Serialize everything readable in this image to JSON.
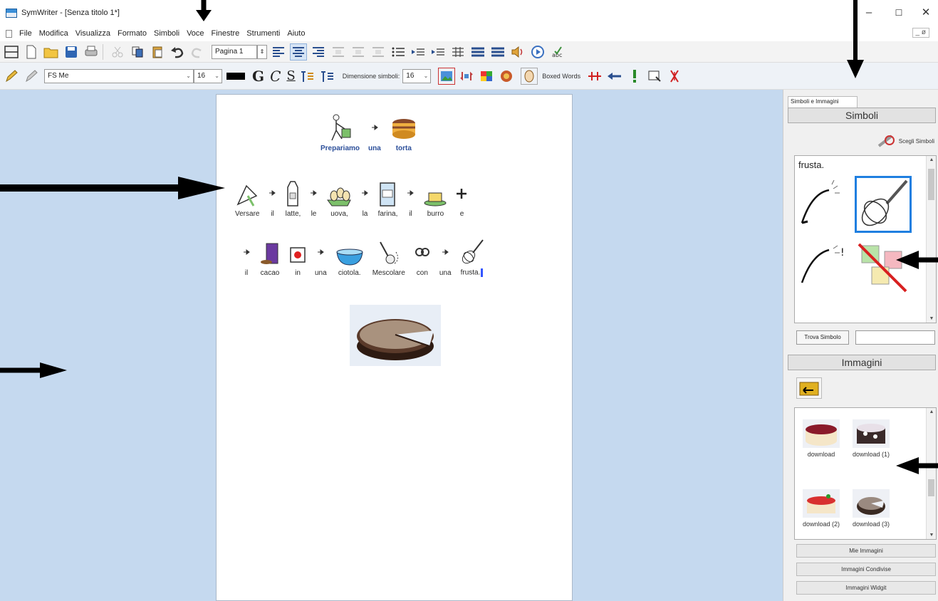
{
  "window": {
    "title": "SymWriter - [Senza titolo 1*]",
    "controls": {
      "minimize": "–",
      "maximize": "☐",
      "close": "✕"
    }
  },
  "menu": {
    "items": [
      "File",
      "Modifica",
      "Visualizza",
      "Formato",
      "Simboli",
      "Voce",
      "Finestre",
      "Strumenti",
      "Aiuto"
    ],
    "mdi_controls": "_ ø"
  },
  "toolbar1": {
    "page_selector": "Pagina 1"
  },
  "toolbar2": {
    "font_name": "FS Me",
    "font_size": "16",
    "bold_label": "G",
    "italic_label": "C",
    "underline_label": "S",
    "symbol_size_label": "Dimensione simboli:",
    "symbol_size_value": "16",
    "boxed_words_label": "Boxed Words"
  },
  "document": {
    "title_row": [
      "Prepariamo",
      "una",
      "torta"
    ],
    "row1": [
      "Versare",
      "il",
      "latte,",
      "le",
      "uova,",
      "la",
      "farina,",
      "il",
      "burro",
      "e"
    ],
    "row2": [
      "il",
      "cacao",
      "in",
      "una",
      "ciotola.",
      "Mescolare",
      "con",
      "una",
      "frusta."
    ]
  },
  "side_panel": {
    "tab_label": "Simboli e Immagini",
    "symbols_header": "Simboli",
    "choose_symbols_label": "Scegli Simboli",
    "search_word": "frusta.",
    "find_symbol_label": "Trova Simbolo",
    "find_symbol_value": "",
    "images_header": "Immagini",
    "images": [
      {
        "label": "download"
      },
      {
        "label": "download (1)"
      },
      {
        "label": "download (2)"
      },
      {
        "label": "download (3)"
      }
    ],
    "my_images_label": "Mie Immagini",
    "shared_images_label": "Immagini Condivise",
    "widgit_images_label": "Immagini Widgit"
  },
  "colors": {
    "workspace_bg": "#c5d9ef",
    "accent_blue": "#2c4f9a",
    "selection_border": "#1f7fe0"
  }
}
